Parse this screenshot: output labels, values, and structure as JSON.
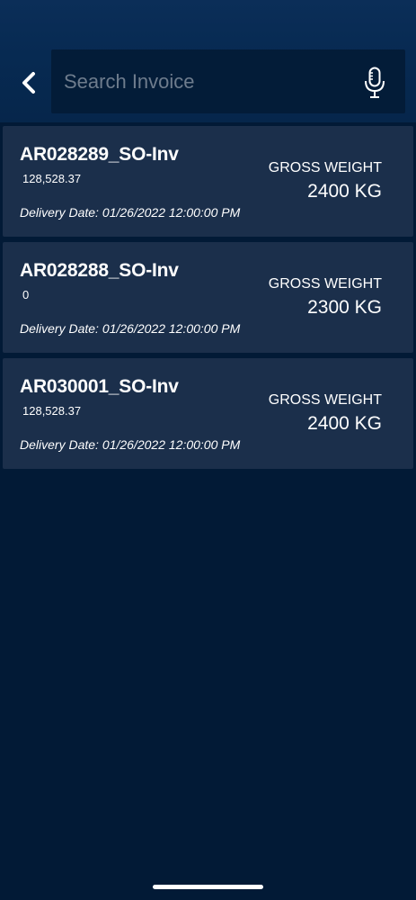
{
  "search": {
    "placeholder": "Search Invoice",
    "value": ""
  },
  "icons": {
    "back": "chevron-left-icon",
    "mic": "microphone-icon"
  },
  "invoices": [
    {
      "number": "AR028289_SO-Inv",
      "amount": "128,528.37",
      "delivery_label": "Delivery Date:",
      "delivery_date": "01/26/2022 12:00:00 PM",
      "gross_weight_label": "GROSS WEIGHT",
      "gross_weight": "2400 KG"
    },
    {
      "number": "AR028288_SO-Inv",
      "amount": "0",
      "delivery_label": "Delivery Date:",
      "delivery_date": "01/26/2022 12:00:00 PM",
      "gross_weight_label": "GROSS WEIGHT",
      "gross_weight": "2300 KG"
    },
    {
      "number": "AR030001_SO-Inv",
      "amount": "128,528.37",
      "delivery_label": "Delivery Date:",
      "delivery_date": "01/26/2022 12:00:00 PM",
      "gross_weight_label": "GROSS WEIGHT",
      "gross_weight": "2400 KG"
    }
  ],
  "colors": {
    "background": "#021A36",
    "header": "#072A52",
    "card": "#1B2F4B",
    "search_box": "#031C38",
    "placeholder": "#6E7C8D",
    "text": "#FFFFFF"
  }
}
